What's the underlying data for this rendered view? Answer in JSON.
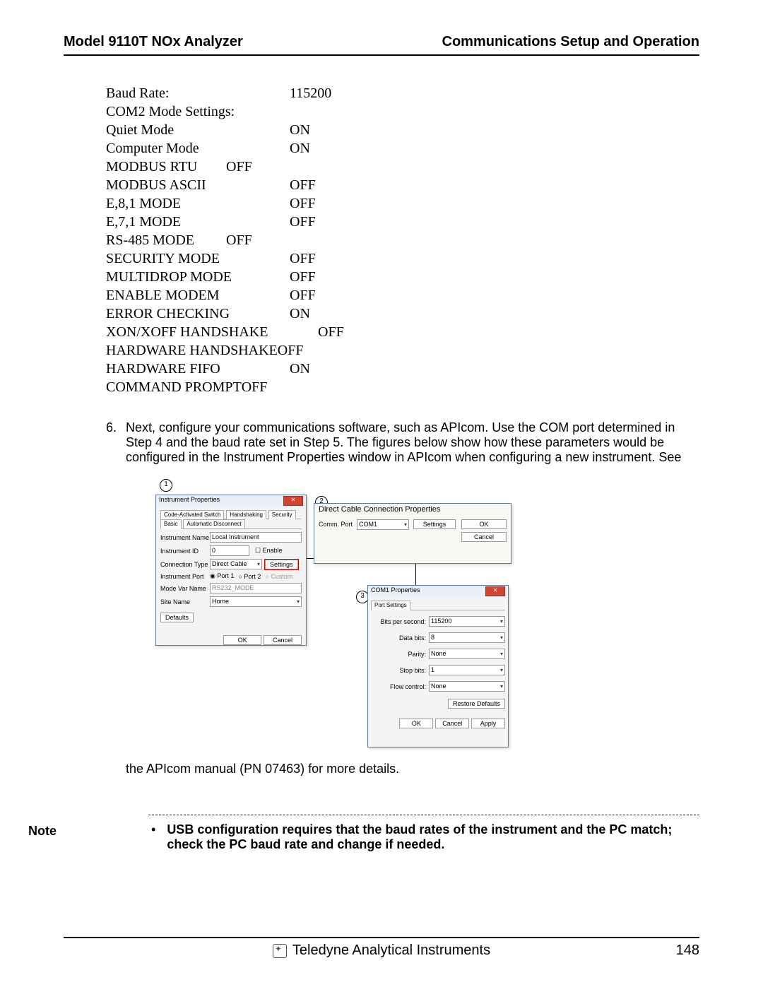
{
  "header": {
    "left": "Model 9110T NOx Analyzer",
    "right": "Communications Setup and Operation"
  },
  "settings": [
    {
      "k": "Baud Rate:",
      "v": "115200"
    },
    {
      "k": "COM2 Mode Settings:",
      "v": ""
    },
    {
      "k": "Quiet Mode",
      "v": "ON"
    },
    {
      "k": "Computer Mode",
      "v": "ON"
    },
    {
      "k": "MODBUS RTU",
      "v": "OFF",
      "tight": true
    },
    {
      "k": "MODBUS ASCII",
      "v": "OFF"
    },
    {
      "k": "E,8,1 MODE",
      "v": "OFF"
    },
    {
      "k": "E,7,1 MODE",
      "v": "OFF"
    },
    {
      "k": "RS-485 MODE",
      "v": "OFF",
      "tight": true
    },
    {
      "k": "SECURITY MODE",
      "v": "OFF"
    },
    {
      "k": "MULTIDROP MODE",
      "v": "OFF"
    },
    {
      "k": "ENABLE MODEM",
      "v": "OFF"
    },
    {
      "k": "ERROR CHECKING",
      "v": "ON"
    },
    {
      "k": "XON/XOFF HANDSHAKE",
      "v": "OFF",
      "wide": true
    },
    {
      "k": "HARDWARE HANDSHAKE",
      "v": "OFF",
      "tight": true
    },
    {
      "k": "HARDWARE FIFO",
      "v": "ON"
    },
    {
      "k": "COMMAND PROMPT",
      "v": "OFF",
      "tight": true
    }
  ],
  "step6": {
    "num": "6.",
    "text": "Next, configure your communications software, such as APIcom.  Use the COM port determined in Step 4 and the baud rate set in Step 5.   The figures below show how these parameters would be configured in the Instrument Properties window in APIcom when configuring a new instrument.  See"
  },
  "afterFig": "the APIcom manual (PN 07463) for more details.",
  "circles": {
    "c1": "1",
    "c2": "2",
    "c3": "3"
  },
  "dlg1": {
    "title": "Instrument Properties",
    "tabs": [
      "Code-Activated Switch",
      "Handshaking",
      "Security",
      "Basic",
      "Automatic Disconnect"
    ],
    "instrumentNameLbl": "Instrument Name",
    "instrumentName": "Local Instrument",
    "instrumentIdLbl": "Instrument ID",
    "instrumentId": "0",
    "enable": "Enable",
    "connTypeLbl": "Connection Type",
    "connType": "Direct Cable",
    "settingsBtn": "Settings",
    "instPortLbl": "Instrument Port",
    "port1": "Port 1",
    "port2": "Port 2",
    "custom": "Custom",
    "modeVarLbl": "Mode Var Name",
    "modeVar": "RS232_MODE",
    "siteNameLbl": "Site Name",
    "siteName": "Home",
    "defaults": "Defaults",
    "ok": "OK",
    "cancel": "Cancel"
  },
  "dlg2": {
    "title": "Direct Cable Connection Properties",
    "commPortLbl": "Comm. Port",
    "commPort": "COM1",
    "settings": "Settings",
    "ok": "OK",
    "cancel": "Cancel"
  },
  "dlg3": {
    "title": "COM1 Properties",
    "tab": "Port Settings",
    "bpsLbl": "Bits per second:",
    "bps": "115200",
    "dbitsLbl": "Data bits:",
    "dbits": "8",
    "parityLbl": "Parity:",
    "parity": "None",
    "sbitsLbl": "Stop bits:",
    "sbits": "1",
    "flowLbl": "Flow control:",
    "flow": "None",
    "restore": "Restore Defaults",
    "ok": "OK",
    "cancel": "Cancel",
    "apply": "Apply"
  },
  "note": {
    "label": "Note",
    "text": "USB configuration requires that the baud rates of the instrument and the PC match; check the PC baud rate and change if needed."
  },
  "footer": {
    "company": "Teledyne Analytical Instruments",
    "page": "148"
  }
}
